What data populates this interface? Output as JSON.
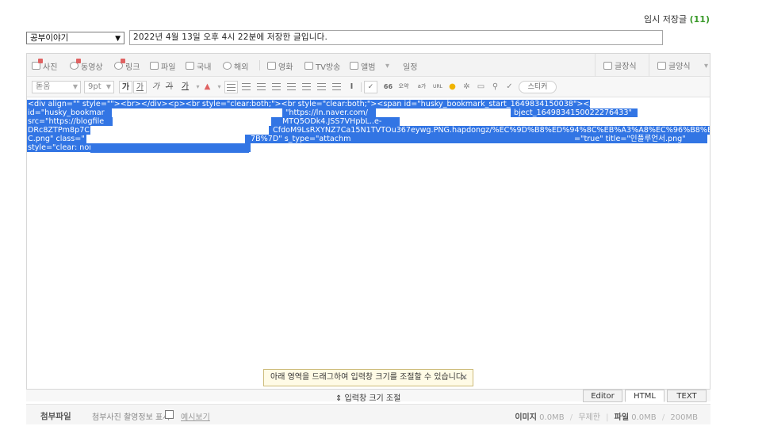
{
  "temp_save": {
    "label": "임시 저장글",
    "count": "(11)"
  },
  "category": {
    "selected": "공부이야기"
  },
  "title": {
    "value": "2022년 4월 13일 오후 4시 22분에 저장한 글입니다."
  },
  "toolbar1": {
    "items": [
      {
        "label": "사진",
        "icon": "photo-icon"
      },
      {
        "label": "동영상",
        "icon": "video-icon"
      },
      {
        "label": "링크",
        "icon": "link-icon"
      },
      {
        "label": "파일",
        "icon": "file-icon"
      },
      {
        "label": "국내",
        "icon": "domestic-map-icon"
      },
      {
        "label": "해외",
        "icon": "globe-icon"
      },
      {
        "label": "영화",
        "icon": "movie-icon"
      },
      {
        "label": "TV방송",
        "icon": "tv-icon"
      },
      {
        "label": "앨범",
        "icon": "album-icon"
      },
      {
        "label": "일정",
        "icon": "calendar-icon"
      }
    ],
    "right": [
      {
        "label": "글장식",
        "icon": "decoration-icon"
      },
      {
        "label": "글양식",
        "icon": "template-icon"
      }
    ]
  },
  "toolbar2": {
    "font": "돋움",
    "size": "9pt",
    "buttons": [
      "가",
      "가",
      "가",
      "가",
      "가"
    ],
    "quote_btn": "66",
    "hanja_btn": "오약",
    "special_btn": "a가",
    "url_btn": "URL",
    "sticker_label": "스티커"
  },
  "editor": {
    "lines": [
      "<div align=\"\" style=\"\"><br></div><p><br style=\"clear:both;\"><br style=\"clear:both;\"><span id=\"husky_bookmark_start_1649834150038\"></span><span",
      "id=\"husky_bookmar",
      "src=\"https://blogfile",
      "DRc8ZTPm8p7C",
      "C.png\" class=\"",
      "style=\"clear: nor"
    ],
    "fragments": [
      "\"https://ln.naver.com/",
      "bject_1649834150022276433\"",
      "MTQ5ODk4.JSS7VHpbL..e-",
      "CfdoM9LsRXYNZ7Ca15N1TVTOu367eywg.PNG.hapdongz/%EC%9D%B8%ED%94%8C%EB%A3%A8%EC%96%B8%EC%84%9",
      "7B%7D\" s_type=\"attachm",
      "=\"true\" title=\"인플루언서.png\""
    ]
  },
  "resize_tip": "아래 영역을 드래그하여 입력창 크기를 조절할 수 있습니다.",
  "resize_label": "⇕ 입력창 크기 조절",
  "mode_tabs": [
    "Editor",
    "HTML",
    "TEXT"
  ],
  "attach": {
    "label": "첨부파일",
    "sub": "첨부사진 촬영정보 표시",
    "example": "예시보기",
    "image_label": "이미지",
    "image_value": "0.0MB",
    "image_limit": "무제한",
    "file_label": "파일",
    "file_value": "0.0MB",
    "file_limit": "200MB"
  }
}
